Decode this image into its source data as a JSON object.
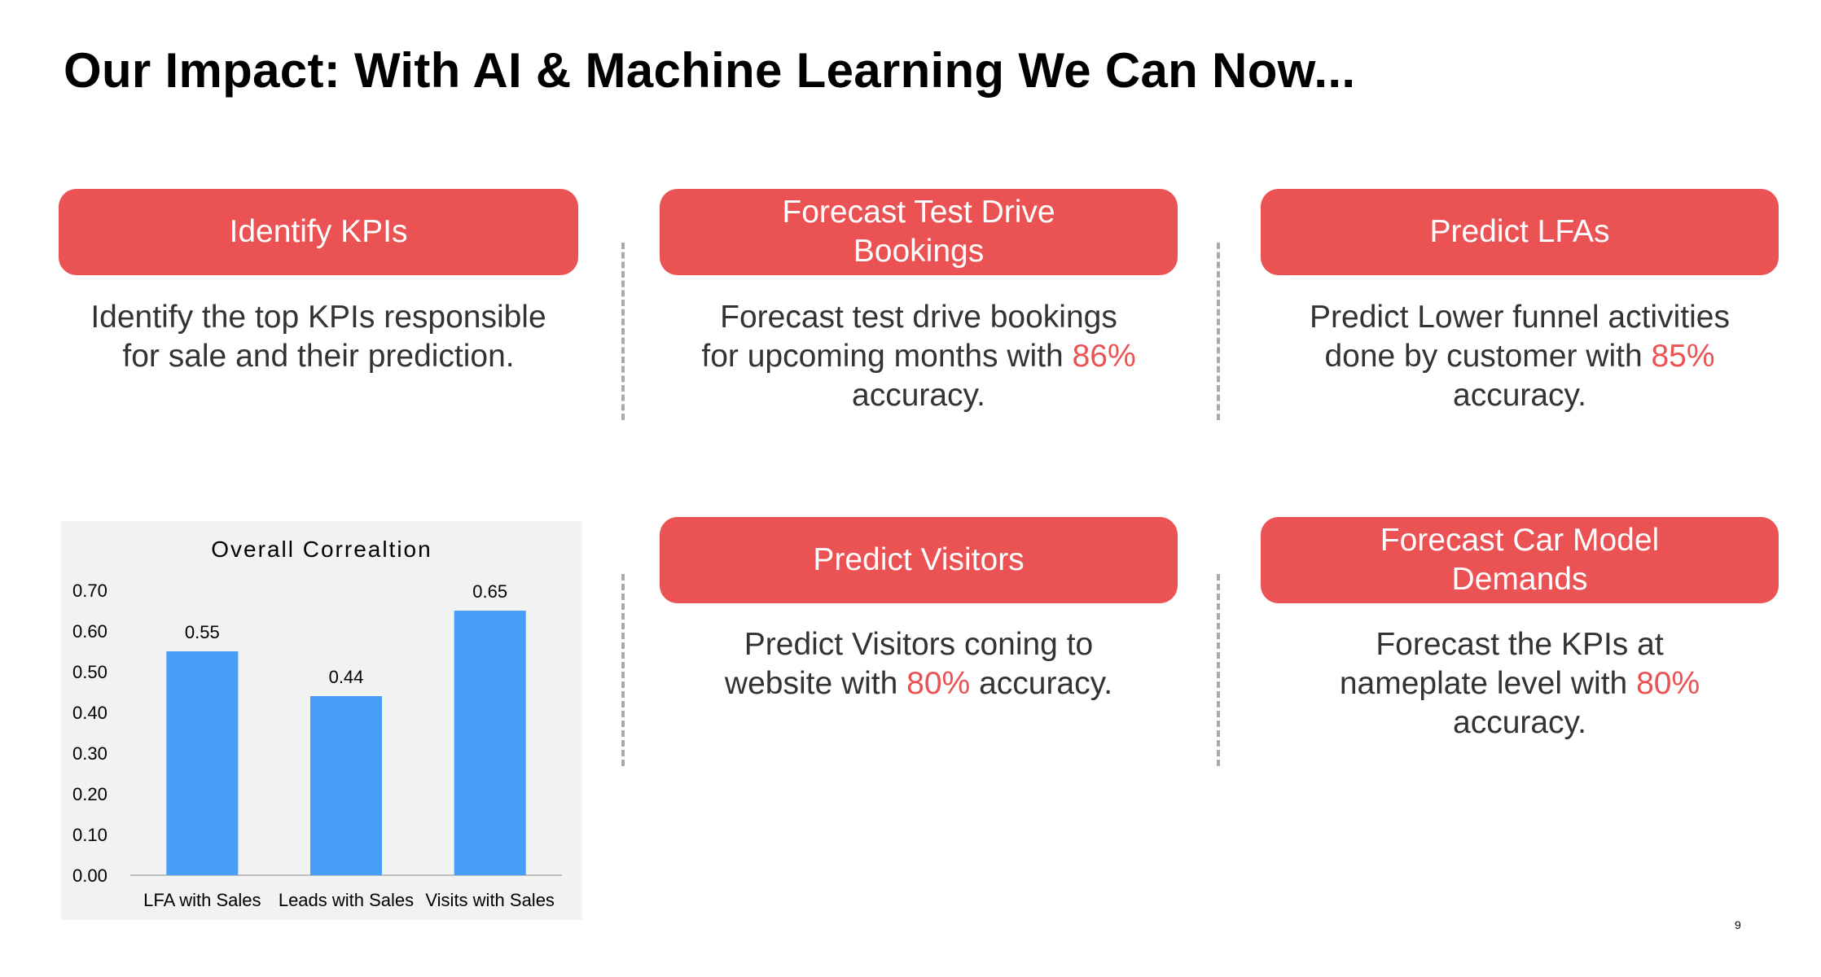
{
  "title": "Our Impact: With AI & Machine Learning We Can Now...",
  "accent_color": "#eb5254",
  "bar_color": "#479ff8",
  "cards": [
    {
      "heading": "Identify KPIs",
      "desc_parts": [
        "Identify the top KPIs responsible for sale and their prediction."
      ]
    },
    {
      "heading": "Forecast Test Drive Bookings",
      "desc_parts": [
        "Forecast test drive bookings for upcoming months with ",
        "86%",
        " accuracy."
      ]
    },
    {
      "heading": "Predict LFAs",
      "desc_parts": [
        "Predict Lower funnel activities done by customer with ",
        "85%",
        " accuracy."
      ]
    },
    {
      "heading": "Predict Visitors",
      "desc_parts": [
        "Predict  Visitors coning to website with ",
        "80%",
        " accuracy."
      ]
    },
    {
      "heading": "Forecast Car Model Demands",
      "desc_parts": [
        "Forecast the KPIs at nameplate level with ",
        "80%",
        " accuracy."
      ]
    }
  ],
  "chart_data": {
    "type": "bar",
    "title": "Overall Correaltion",
    "categories": [
      "LFA with Sales",
      "Leads with Sales",
      "Visits with Sales"
    ],
    "values": [
      0.55,
      0.44,
      0.65
    ],
    "value_labels": [
      "0.55",
      "0.44",
      "0.65"
    ],
    "ylim": [
      0,
      0.7
    ],
    "yticks": [
      "0.00",
      "0.10",
      "0.20",
      "0.30",
      "0.40",
      "0.50",
      "0.60",
      "0.70"
    ],
    "grid": false,
    "legend": "none"
  },
  "page_number": "9"
}
